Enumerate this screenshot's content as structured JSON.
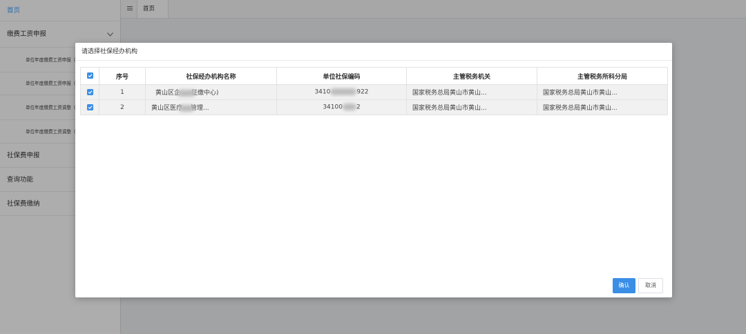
{
  "colors": {
    "accent": "#3a8ee6",
    "sidebar_active": "#409eff"
  },
  "sidebar": {
    "home": "首页",
    "group": {
      "label": "缴费工资申报",
      "expand_icon": "chevron-down-icon",
      "children": [
        "单位年度缴费工资申报（",
        "单位年度缴费工资申报（",
        "单位年度缴费工资调整（",
        "单位年度缴费工资调整（"
      ]
    },
    "items": [
      "社保费申报",
      "查询功能",
      "社保费缴纳"
    ]
  },
  "topbar": {
    "menu_icon": "menu-icon",
    "tabs": [
      {
        "label": "首页"
      }
    ]
  },
  "modal": {
    "title": "请选择社保经办机构",
    "table": {
      "select_all_checked": true,
      "columns": {
        "index": "序号",
        "name": "社保经办机构名称",
        "code": "单位社保编码",
        "tax_authority": "主管税务机关",
        "tax_bureau": "主管税务所科分局"
      },
      "rows": [
        {
          "checked": true,
          "index": "1",
          "name": {
            "start": "黄山区企",
            "end": "征缴中心)"
          },
          "code": {
            "start": "3410",
            "end": "922"
          },
          "tax_authority": "国家税务总局黄山市黄山...",
          "tax_bureau": "国家税务总局黄山市黄山..."
        },
        {
          "checked": true,
          "index": "2",
          "name": {
            "start": "黄山区医疗",
            "end": "管理..."
          },
          "code": {
            "start": "34100",
            "end": "2"
          },
          "tax_authority": "国家税务总局黄山市黄山...",
          "tax_bureau": "国家税务总局黄山市黄山..."
        }
      ]
    },
    "buttons": {
      "confirm": "确认",
      "cancel": "取消"
    }
  }
}
